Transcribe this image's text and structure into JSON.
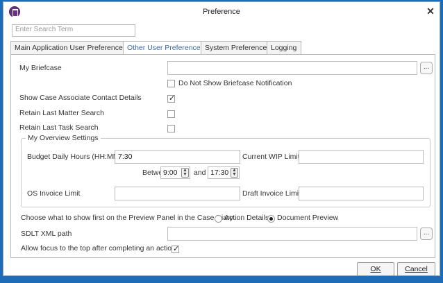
{
  "window": {
    "title": "Preference"
  },
  "search": {
    "placeholder": "Enter Search Term"
  },
  "tabs": [
    {
      "label": "Main Application User Preferences"
    },
    {
      "label": "Other User Preferences"
    },
    {
      "label": "System Preferences"
    },
    {
      "label": "Logging"
    }
  ],
  "form": {
    "my_briefcase": {
      "label": "My Briefcase",
      "value": "",
      "browse_label": "..."
    },
    "do_not_show_briefcase": {
      "label": "Do Not Show Briefcase Notification",
      "checked": false
    },
    "show_case_associate": {
      "label": "Show Case Associate Contact Details",
      "checked": true
    },
    "retain_last_matter": {
      "label": "Retain Last Matter Search",
      "checked": false
    },
    "retain_last_task": {
      "label": "Retain Last Task Search",
      "checked": false
    },
    "overview": {
      "title": "My Overview Settings",
      "budget_label": "Budget Daily Hours (HH:MM)",
      "budget_value": "7:30",
      "current_wip_label": "Current WIP Limit",
      "current_wip_value": "",
      "between_label": "Between",
      "between_from": "9:00",
      "and_label": "and",
      "between_to": "17:30",
      "os_invoice_label": "OS Invoice Limit",
      "os_invoice_value": "",
      "draft_invoice_label": "Draft Invoice Limit",
      "draft_invoice_value": ""
    },
    "preview_panel": {
      "label": "Choose what to show first on the Preview Panel in the Case Diary",
      "options": [
        {
          "label": "Action Details",
          "selected": false
        },
        {
          "label": "Document Preview",
          "selected": true
        }
      ]
    },
    "sdlt_xml": {
      "label": "SDLT XML path",
      "value": "",
      "browse_label": "..."
    },
    "allow_focus": {
      "label": "Allow focus to the top after completing an action",
      "checked": true
    }
  },
  "buttons": {
    "ok": "OK",
    "cancel": "Cancel"
  }
}
